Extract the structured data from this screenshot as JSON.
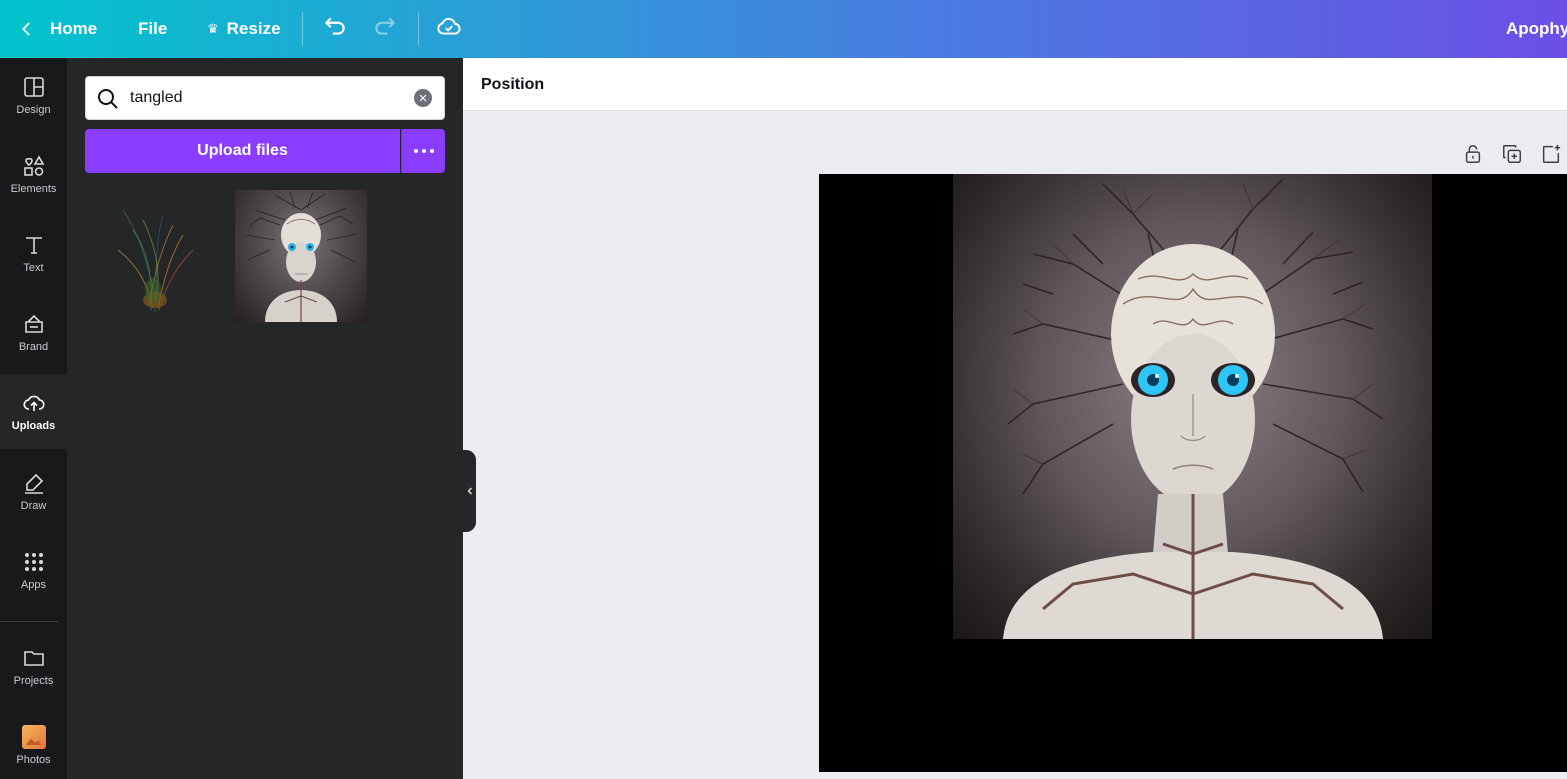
{
  "topbar": {
    "home_label": "Home",
    "file_label": "File",
    "resize_label": "Resize",
    "title": "Apophys",
    "icons": [
      "chevron-left-icon",
      "crown-icon",
      "undo-icon",
      "redo-icon",
      "cloud-saved-icon"
    ]
  },
  "rail": {
    "items": [
      {
        "label": "Design",
        "icon": "layout-icon"
      },
      {
        "label": "Elements",
        "icon": "shapes-icon"
      },
      {
        "label": "Text",
        "icon": "text-icon"
      },
      {
        "label": "Brand",
        "icon": "brand-icon"
      },
      {
        "label": "Uploads",
        "icon": "cloud-upload-icon",
        "active": true
      },
      {
        "label": "Draw",
        "icon": "pen-icon"
      },
      {
        "label": "Apps",
        "icon": "grid-icon"
      },
      {
        "label": "Projects",
        "icon": "folder-icon"
      },
      {
        "label": "Photos",
        "icon": "photos-icon"
      }
    ]
  },
  "panel": {
    "search_value": "tangled",
    "upload_label": "Upload files"
  },
  "context": {
    "position_label": "Position"
  },
  "colors": {
    "accent": "#8b3dff",
    "rail_bg": "#18191b",
    "panel_bg": "#252627",
    "canvas_bg": "#ebecf0"
  }
}
